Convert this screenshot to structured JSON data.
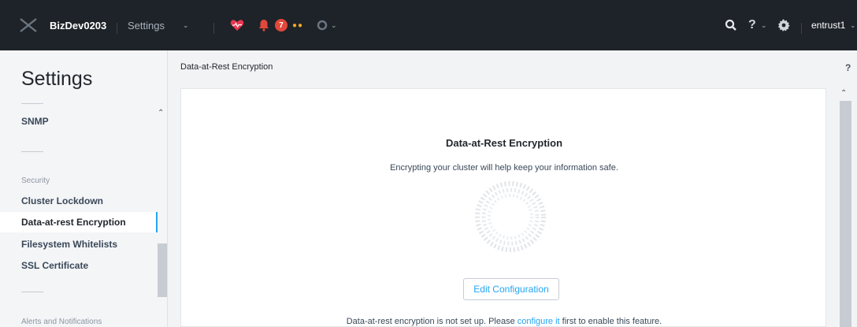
{
  "topbar": {
    "cluster_name": "BizDev0203",
    "page_name": "Settings",
    "alert_count": "7",
    "user_name": "entrust1",
    "help_label": "?"
  },
  "sidebar": {
    "title": "Settings",
    "items": {
      "snmp": "SNMP",
      "security_section": "Security",
      "cluster_lockdown": "Cluster Lockdown",
      "data_at_rest": "Data-at-rest Encryption",
      "filesystem_whitelists": "Filesystem Whitelists",
      "ssl_certificate": "SSL Certificate",
      "alerts_section": "Alerts and Notifications"
    }
  },
  "main": {
    "header_title": "Data-at-Rest Encryption",
    "help_label": "?",
    "card": {
      "title": "Data-at-Rest Encryption",
      "description": "Encrypting your cluster will help keep your information safe.",
      "edit_button": "Edit Configuration",
      "status_prefix": "Data-at-rest encryption is not set up. Please ",
      "status_link": "configure it",
      "status_suffix": " first to enable this feature."
    }
  },
  "colors": {
    "topbar_bg": "#1e2329",
    "accent": "#22a5f7",
    "alert": "#e0483b",
    "warning_dots": "#f5a623",
    "health_icon": "#e8384f"
  },
  "icons": [
    "x-logo-icon",
    "chevron-down-icon",
    "heart-health-icon",
    "bell-alert-icon",
    "dots-icon",
    "circle-status-icon",
    "search-icon",
    "help-icon",
    "gear-icon"
  ]
}
